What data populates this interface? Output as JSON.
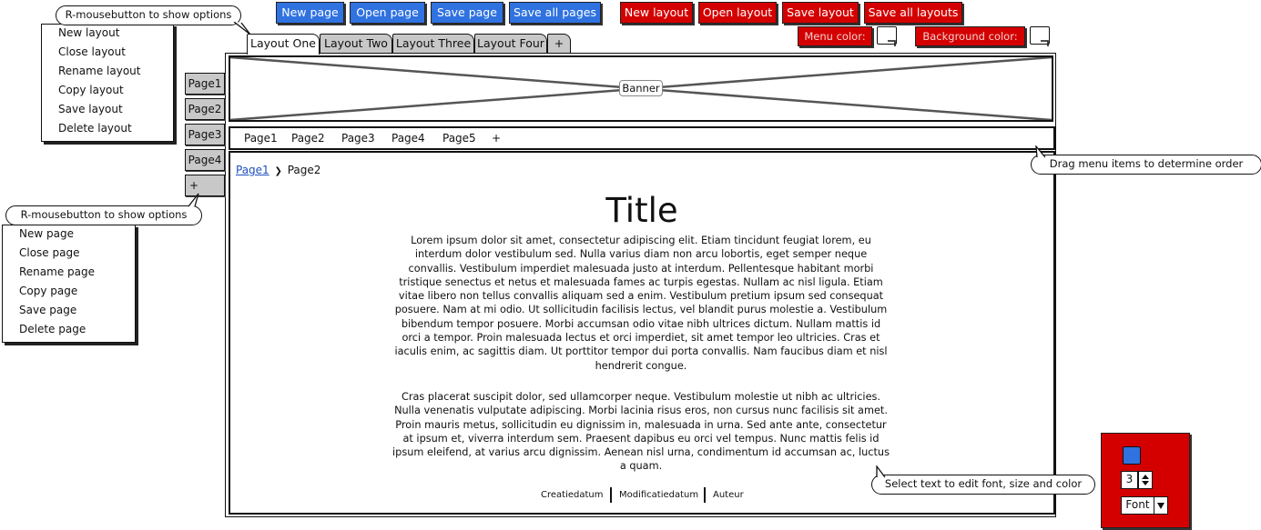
{
  "toolbar": {
    "page_buttons": [
      "New page",
      "Open page",
      "Save page",
      "Save all pages"
    ],
    "layout_buttons": [
      "New layout",
      "Open layout",
      "Save layout",
      "Save all layouts"
    ],
    "menu_color_label": "Menu color:",
    "background_color_label": "Background color:",
    "page_button_color": "#2f72e0",
    "layout_button_color": "#d40000"
  },
  "tabs": [
    "Layout One",
    "Layout Two",
    "Layout Three",
    "Layout Four",
    "+"
  ],
  "active_tab": "Layout One",
  "callouts": {
    "layout_options": "R-mousebutton to show options",
    "page_options": "R-mousebutton to show options",
    "drag_hint": "Drag menu items to determine order",
    "text_hint": "Select text to edit font, size and color"
  },
  "layout_menu": [
    "New layout",
    "Close layout",
    "Rename layout",
    "Copy layout",
    "Save layout",
    "Delete layout"
  ],
  "page_menu": [
    "New page",
    "Close page",
    "Rename page",
    "Copy page",
    "Save page",
    "Delete page"
  ],
  "side_tabs": [
    "Page1",
    "Page2",
    "Page3",
    "Page4",
    "+"
  ],
  "banner_label": "Banner",
  "nav_items": [
    "Page1",
    "Page2",
    "Page3",
    "Page4",
    "Page5",
    "+"
  ],
  "breadcrumb": {
    "link": "Page1",
    "separator": "❯",
    "current": "Page2"
  },
  "content": {
    "title": "Title",
    "paragraph1": "Lorem ipsum dolor sit amet, consectetur adipiscing elit. Etiam tincidunt feugiat lorem, eu interdum dolor vestibulum sed. Nulla varius diam non arcu lobortis, eget semper neque convallis. Vestibulum imperdiet malesuada justo at interdum. Pellentesque habitant morbi tristique senectus et netus et malesuada fames ac turpis egestas. Nullam ac nisl ligula. Etiam vitae libero non tellus convallis aliquam sed a enim. Vestibulum pretium ipsum sed consequat posuere. Nam at mi odio. Ut sollicitudin facilisis lectus, vel blandit purus molestie a. Vestibulum bibendum tempor posuere. Morbi accumsan odio vitae nibh ultrices dictum. Nullam mattis id orci a tempor. Proin malesuada lectus et orci imperdiet, sit amet tempor leo ultricies. Cras et iaculis enim, ac sagittis diam. Ut porttitor tempor dui porta convallis. Nam faucibus diam et nisl hendrerit congue.",
    "paragraph2": "Cras placerat suscipit dolor, sed ullamcorper neque. Vestibulum molestie ut nibh ac ultricies. Nulla venenatis vulputate adipiscing. Morbi lacinia risus eros, non cursus nunc facilisis sit amet. Proin mauris metus, sollicitudin eu dignissim in, malesuada in urna. Sed ante ante, consectetur at ipsum et, viverra interdum sem. Praesent dapibus eu orci vel tempus. Nunc mattis felis id ipsum eleifend, at varius arcu dignissim. Aenean nisl urna, condimentum id accumsan ac, luctus a quam."
  },
  "footer": [
    "Creatiedatum",
    "Modificatiedatum",
    "Auteur"
  ],
  "format_panel": {
    "size_value": "3",
    "font_label": "Font",
    "panel_color": "#d40000",
    "text_color": "#2f72e0"
  }
}
